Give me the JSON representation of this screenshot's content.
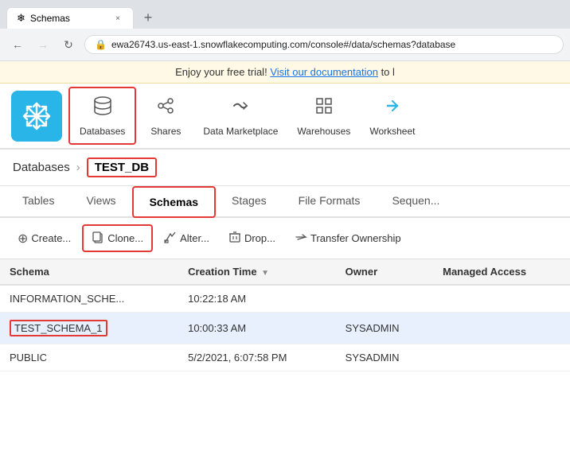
{
  "browser": {
    "tab_favicon": "❄",
    "tab_title": "Schemas",
    "tab_close": "×",
    "new_tab": "+",
    "back_btn": "←",
    "forward_btn": "→",
    "refresh_btn": "↻",
    "address": "ewa26743.us-east-1.snowflakecomputing.com/console#/data/schemas?database",
    "lock_icon": "🔒"
  },
  "banner": {
    "text": "Enjoy your free trial!",
    "link_text": "Visit our documentation",
    "suffix": " to l"
  },
  "nav": {
    "items": [
      {
        "id": "databases",
        "label": "Databases",
        "icon": "🗄",
        "active": true
      },
      {
        "id": "shares",
        "label": "Shares",
        "icon": "🔀"
      },
      {
        "id": "data-marketplace",
        "label": "Data Marketplace",
        "icon": "⇄"
      },
      {
        "id": "warehouses",
        "label": "Warehouses",
        "icon": "⊞"
      },
      {
        "id": "worksheets",
        "label": "Worksheet",
        "icon": "▶"
      }
    ]
  },
  "breadcrumb": {
    "parent": "Databases",
    "separator": "›",
    "current": "TEST_DB"
  },
  "tabs": [
    {
      "id": "tables",
      "label": "Tables"
    },
    {
      "id": "views",
      "label": "Views"
    },
    {
      "id": "schemas",
      "label": "Schemas",
      "active": true
    },
    {
      "id": "stages",
      "label": "Stages"
    },
    {
      "id": "file-formats",
      "label": "File Formats"
    },
    {
      "id": "sequences",
      "label": "Sequen..."
    }
  ],
  "toolbar": {
    "create_label": "Create...",
    "clone_label": "Clone...",
    "alter_label": "Alter...",
    "drop_label": "Drop...",
    "transfer_label": "Transfer Ownership"
  },
  "table": {
    "columns": [
      {
        "id": "schema",
        "label": "Schema"
      },
      {
        "id": "creation_time",
        "label": "Creation Time",
        "sortable": true
      },
      {
        "id": "owner",
        "label": "Owner"
      },
      {
        "id": "managed_access",
        "label": "Managed Access"
      }
    ],
    "rows": [
      {
        "schema": "INFORMATION_SCHE...",
        "creation_time": "10:22:18 AM",
        "owner": "",
        "managed_access": "",
        "selected": false
      },
      {
        "schema": "TEST_SCHEMA_1",
        "creation_time": "10:00:33 AM",
        "owner": "SYSADMIN",
        "managed_access": "",
        "selected": true
      },
      {
        "schema": "PUBLIC",
        "creation_time": "5/2/2021, 6:07:58 PM",
        "owner": "SYSADMIN",
        "managed_access": "",
        "selected": false
      }
    ]
  }
}
